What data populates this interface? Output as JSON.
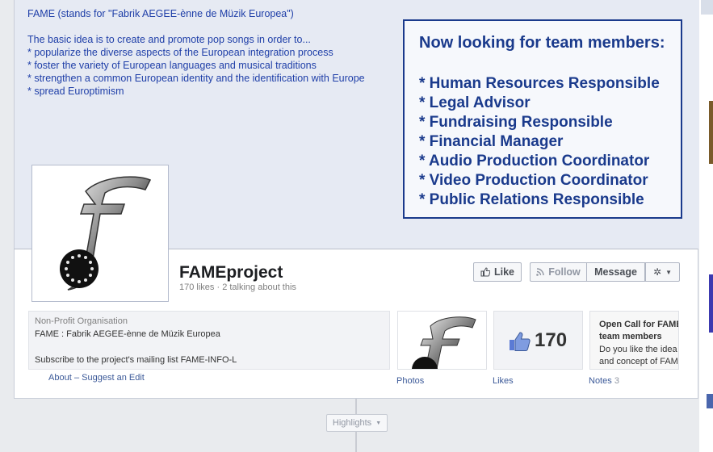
{
  "cover": {
    "lines": [
      "FAME (stands for \"Fabrik AEGEE-ènne de Müzik Europea\")",
      "",
      "The basic idea is to create and promote pop songs in order to...",
      "* popularize the diverse aspects of the European integration process",
      "* foster the variety of European languages and musical traditions",
      "* strengthen a common European identity and the identification with Europe",
      "* spread Europtimism"
    ],
    "team_title": "Now looking for team members:",
    "team_roles": [
      "* Human Resources Responsible",
      "* Legal Advisor",
      "* Fundraising Responsible",
      "* Financial Manager",
      "* Audio Production Coordinator",
      "* Video Production Coordinator",
      "* Public Relations Responsible"
    ]
  },
  "page": {
    "name": "FAMEproject",
    "stats": "170 likes · 2 talking about this"
  },
  "actions": {
    "like": "Like",
    "follow": "Follow",
    "message": "Message"
  },
  "about": {
    "category": "Non-Profit Organisation",
    "name": "FAME : Fabrik AEGEE-ènne de Müzik Europea",
    "subscribe": "Subscribe to the project's mailing list FAME-INFO-L",
    "about_link": "About",
    "suggest_link": "– Suggest an Edit"
  },
  "apps": {
    "photos_label": "Photos",
    "likes_label": "Likes",
    "likes_count": "170",
    "notes_label": "Notes",
    "notes_count": "3",
    "note_title": "Open Call for FAME team members",
    "note_body": "Do you like the idea and concept of FAME and"
  },
  "timeline": {
    "highlights": "Highlights"
  },
  "colors": {
    "accent": "#3b5998",
    "cover_text": "#1f3fa8",
    "team_box": "#1a3a8c"
  }
}
